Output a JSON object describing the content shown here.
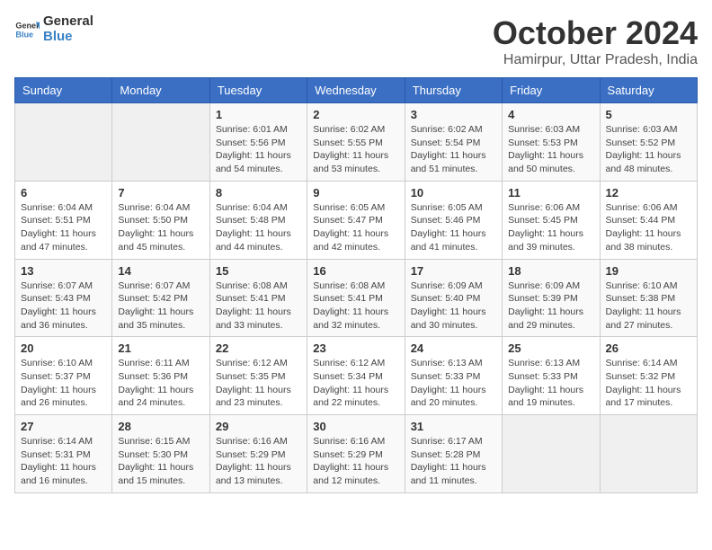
{
  "logo": {
    "general": "General",
    "blue": "Blue"
  },
  "title": "October 2024",
  "subtitle": "Hamirpur, Uttar Pradesh, India",
  "days_of_week": [
    "Sunday",
    "Monday",
    "Tuesday",
    "Wednesday",
    "Thursday",
    "Friday",
    "Saturday"
  ],
  "weeks": [
    [
      {
        "day": "",
        "info": ""
      },
      {
        "day": "",
        "info": ""
      },
      {
        "day": "1",
        "info": "Sunrise: 6:01 AM\nSunset: 5:56 PM\nDaylight: 11 hours and 54 minutes."
      },
      {
        "day": "2",
        "info": "Sunrise: 6:02 AM\nSunset: 5:55 PM\nDaylight: 11 hours and 53 minutes."
      },
      {
        "day": "3",
        "info": "Sunrise: 6:02 AM\nSunset: 5:54 PM\nDaylight: 11 hours and 51 minutes."
      },
      {
        "day": "4",
        "info": "Sunrise: 6:03 AM\nSunset: 5:53 PM\nDaylight: 11 hours and 50 minutes."
      },
      {
        "day": "5",
        "info": "Sunrise: 6:03 AM\nSunset: 5:52 PM\nDaylight: 11 hours and 48 minutes."
      }
    ],
    [
      {
        "day": "6",
        "info": "Sunrise: 6:04 AM\nSunset: 5:51 PM\nDaylight: 11 hours and 47 minutes."
      },
      {
        "day": "7",
        "info": "Sunrise: 6:04 AM\nSunset: 5:50 PM\nDaylight: 11 hours and 45 minutes."
      },
      {
        "day": "8",
        "info": "Sunrise: 6:04 AM\nSunset: 5:48 PM\nDaylight: 11 hours and 44 minutes."
      },
      {
        "day": "9",
        "info": "Sunrise: 6:05 AM\nSunset: 5:47 PM\nDaylight: 11 hours and 42 minutes."
      },
      {
        "day": "10",
        "info": "Sunrise: 6:05 AM\nSunset: 5:46 PM\nDaylight: 11 hours and 41 minutes."
      },
      {
        "day": "11",
        "info": "Sunrise: 6:06 AM\nSunset: 5:45 PM\nDaylight: 11 hours and 39 minutes."
      },
      {
        "day": "12",
        "info": "Sunrise: 6:06 AM\nSunset: 5:44 PM\nDaylight: 11 hours and 38 minutes."
      }
    ],
    [
      {
        "day": "13",
        "info": "Sunrise: 6:07 AM\nSunset: 5:43 PM\nDaylight: 11 hours and 36 minutes."
      },
      {
        "day": "14",
        "info": "Sunrise: 6:07 AM\nSunset: 5:42 PM\nDaylight: 11 hours and 35 minutes."
      },
      {
        "day": "15",
        "info": "Sunrise: 6:08 AM\nSunset: 5:41 PM\nDaylight: 11 hours and 33 minutes."
      },
      {
        "day": "16",
        "info": "Sunrise: 6:08 AM\nSunset: 5:41 PM\nDaylight: 11 hours and 32 minutes."
      },
      {
        "day": "17",
        "info": "Sunrise: 6:09 AM\nSunset: 5:40 PM\nDaylight: 11 hours and 30 minutes."
      },
      {
        "day": "18",
        "info": "Sunrise: 6:09 AM\nSunset: 5:39 PM\nDaylight: 11 hours and 29 minutes."
      },
      {
        "day": "19",
        "info": "Sunrise: 6:10 AM\nSunset: 5:38 PM\nDaylight: 11 hours and 27 minutes."
      }
    ],
    [
      {
        "day": "20",
        "info": "Sunrise: 6:10 AM\nSunset: 5:37 PM\nDaylight: 11 hours and 26 minutes."
      },
      {
        "day": "21",
        "info": "Sunrise: 6:11 AM\nSunset: 5:36 PM\nDaylight: 11 hours and 24 minutes."
      },
      {
        "day": "22",
        "info": "Sunrise: 6:12 AM\nSunset: 5:35 PM\nDaylight: 11 hours and 23 minutes."
      },
      {
        "day": "23",
        "info": "Sunrise: 6:12 AM\nSunset: 5:34 PM\nDaylight: 11 hours and 22 minutes."
      },
      {
        "day": "24",
        "info": "Sunrise: 6:13 AM\nSunset: 5:33 PM\nDaylight: 11 hours and 20 minutes."
      },
      {
        "day": "25",
        "info": "Sunrise: 6:13 AM\nSunset: 5:33 PM\nDaylight: 11 hours and 19 minutes."
      },
      {
        "day": "26",
        "info": "Sunrise: 6:14 AM\nSunset: 5:32 PM\nDaylight: 11 hours and 17 minutes."
      }
    ],
    [
      {
        "day": "27",
        "info": "Sunrise: 6:14 AM\nSunset: 5:31 PM\nDaylight: 11 hours and 16 minutes."
      },
      {
        "day": "28",
        "info": "Sunrise: 6:15 AM\nSunset: 5:30 PM\nDaylight: 11 hours and 15 minutes."
      },
      {
        "day": "29",
        "info": "Sunrise: 6:16 AM\nSunset: 5:29 PM\nDaylight: 11 hours and 13 minutes."
      },
      {
        "day": "30",
        "info": "Sunrise: 6:16 AM\nSunset: 5:29 PM\nDaylight: 11 hours and 12 minutes."
      },
      {
        "day": "31",
        "info": "Sunrise: 6:17 AM\nSunset: 5:28 PM\nDaylight: 11 hours and 11 minutes."
      },
      {
        "day": "",
        "info": ""
      },
      {
        "day": "",
        "info": ""
      }
    ]
  ]
}
